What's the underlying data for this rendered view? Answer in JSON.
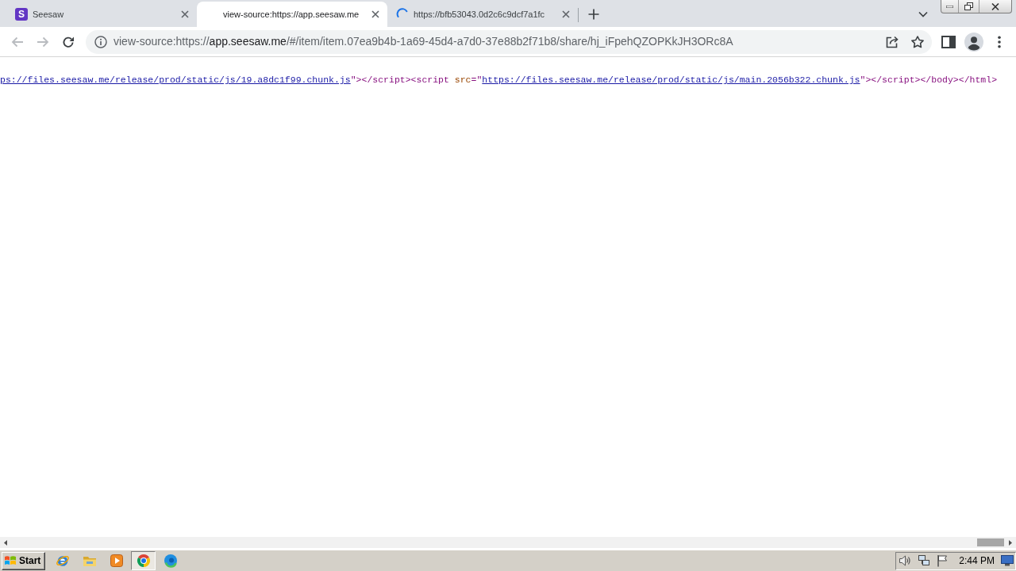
{
  "browser": {
    "tabs": [
      {
        "kind": "site",
        "logo": "S",
        "title": "Seesaw",
        "selected": false
      },
      {
        "kind": "blank",
        "title": "view-source:https://app.seesaw.me",
        "selected": true
      },
      {
        "kind": "loading",
        "title": "https://bfb53043.0d2c6c9dcf7a1fc",
        "selected": false
      }
    ],
    "toolbar": {
      "back_disabled": true,
      "forward_disabled": true,
      "address": {
        "scheme": "view-source:https://",
        "host": "app.seesaw.me",
        "path": "/#/item/item.07ea9b4b-1a69-45d4-a7d0-37e88b2f71b8/share/hj_iFpehQZOPKkJH3ORc8A"
      }
    }
  },
  "source_view": {
    "lines": [
      {
        "segments": [
          {
            "kind": "link",
            "text": "ps://files.seesaw.me/release/prod/static/js/19.a8dc1f99.chunk.js"
          },
          {
            "kind": "tag",
            "text": "\"></script><script "
          },
          {
            "kind": "attr",
            "text": "src"
          },
          {
            "kind": "tag",
            "text": "=\""
          },
          {
            "kind": "link",
            "text": "https://files.seesaw.me/release/prod/static/js/main.2056b322.chunk.js"
          },
          {
            "kind": "tag",
            "text": "\"></script></body></html>"
          }
        ]
      }
    ]
  },
  "taskbar": {
    "start_label": "Start",
    "apps": [
      {
        "active": false
      },
      {
        "active": false
      },
      {
        "active": false
      },
      {
        "active": true
      },
      {
        "active": false
      }
    ],
    "clock": "2:44 PM"
  }
}
